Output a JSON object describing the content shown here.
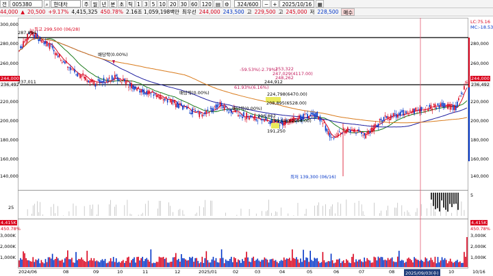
{
  "toolbar": {
    "market_btn": "전",
    "code_label": "005380",
    "name_label": "현대차",
    "periods": [
      "주",
      "월",
      "년",
      "분",
      "초",
      "틱"
    ],
    "intervals": [
      "1",
      "3",
      "5",
      "10",
      "20",
      "30",
      "60",
      "120"
    ],
    "count_value": "324",
    "count_total": "600",
    "date_value": "2025/10/16",
    "apply_btn": "▦"
  },
  "quote": {
    "last": "44,000",
    "change": "20,500",
    "change_pct": "+9.17%",
    "volume": "4,415,325",
    "vol_ratio": "450.78%",
    "turnover": "2.16조 1,059,198백만",
    "mode": "최우선",
    "open_label": "244,000",
    "high_label": "243,500",
    "high_prefix": "고",
    "high_value": "229,500",
    "low_prefix": "고",
    "low_value": "245,000",
    "close_prefix": "저",
    "close_value": "228,500",
    "buy_btn": "매수"
  },
  "axes": {
    "price_ticks": [
      "300,000",
      "280,000",
      "260,000",
      "240,000",
      "220,000",
      "200,000",
      "180,000",
      "160,000",
      "140,000"
    ],
    "osc_tick": "25",
    "osc_right": "5",
    "vol_ticks": [
      "3,000K",
      "2,000K",
      "1,000K"
    ],
    "x_labels": [
      "2024/06",
      "08",
      "09",
      "10",
      "11",
      "12",
      "2025/01",
      "02",
      "03",
      "04",
      "05",
      "06",
      "07",
      "08",
      "09",
      "10",
      "10/16"
    ],
    "cursor_date": "2025/09/03(수)",
    "right_tags": {
      "lc": "LC:75.16",
      "mc": "MC:-18.53",
      "price_now": "244,000",
      "price_ref": "236,492",
      "vol_now": "4,415K",
      "vol_pct": "450.78%"
    },
    "left_tags": {
      "price_now": "244,000",
      "price_ref": "236,492",
      "vol_now": "4,415K",
      "vol_pct": "450.78%"
    }
  },
  "annotations": {
    "high": "최고 299,500 (06/28)",
    "high_short": "287,894",
    "line_level": "237,011",
    "dividend1": "배당락(0.00%)",
    "dividend2": "배당락(0.00%)",
    "dividend3": "배당락(0.00%)",
    "low": "최저 139,300 (06/16)",
    "pct_note": "-59.53%(-2.79%)",
    "lvl_a": "253,322",
    "lvl_b": "247,029(4117.00)",
    "lvl_c": "248,262",
    "lvl_d": "244,912",
    "pct_b": "61.93%(6.16%)",
    "lvl_e": "224,798(6470.00)",
    "lvl_f": "208,895(6528.00)",
    "lvl_g": "206,862",
    "lvl_h": "199,580(2994.00)",
    "lvl_i": "191,250"
  },
  "colors": {
    "up": "#d9001b",
    "down": "#0034c7",
    "ma5": "#d9001b",
    "ma20": "#1a7a1a",
    "ma60": "#1a1a9e",
    "ma120": "#d97a1a"
  }
}
